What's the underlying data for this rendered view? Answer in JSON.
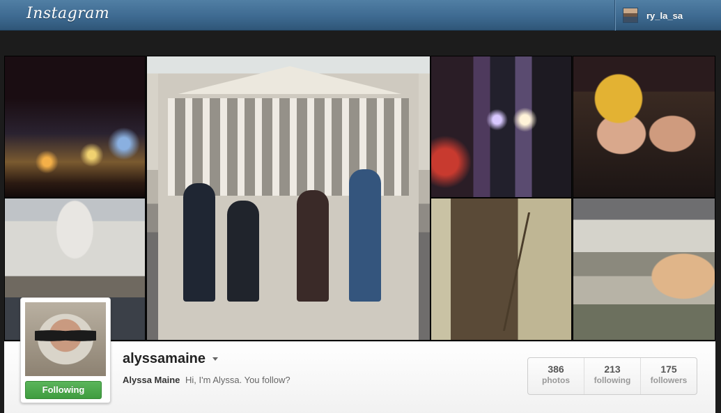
{
  "header": {
    "logo_text": "Instagram",
    "current_user": "ry_la_sa"
  },
  "profile": {
    "username": "alyssamaine",
    "full_name": "Alyssa Maine",
    "bio": "Hi, I'm Alyssa. You follow?",
    "follow_status": "Following",
    "follow_color": "#4aa84a"
  },
  "stats": [
    {
      "value": "386",
      "label": "photos"
    },
    {
      "value": "213",
      "label": "following"
    },
    {
      "value": "175",
      "label": "followers"
    }
  ],
  "icons": {
    "caret": "chevron-down-icon"
  },
  "colors": {
    "header_blue": "#3f6b92",
    "following_green": "#4aa84a"
  }
}
